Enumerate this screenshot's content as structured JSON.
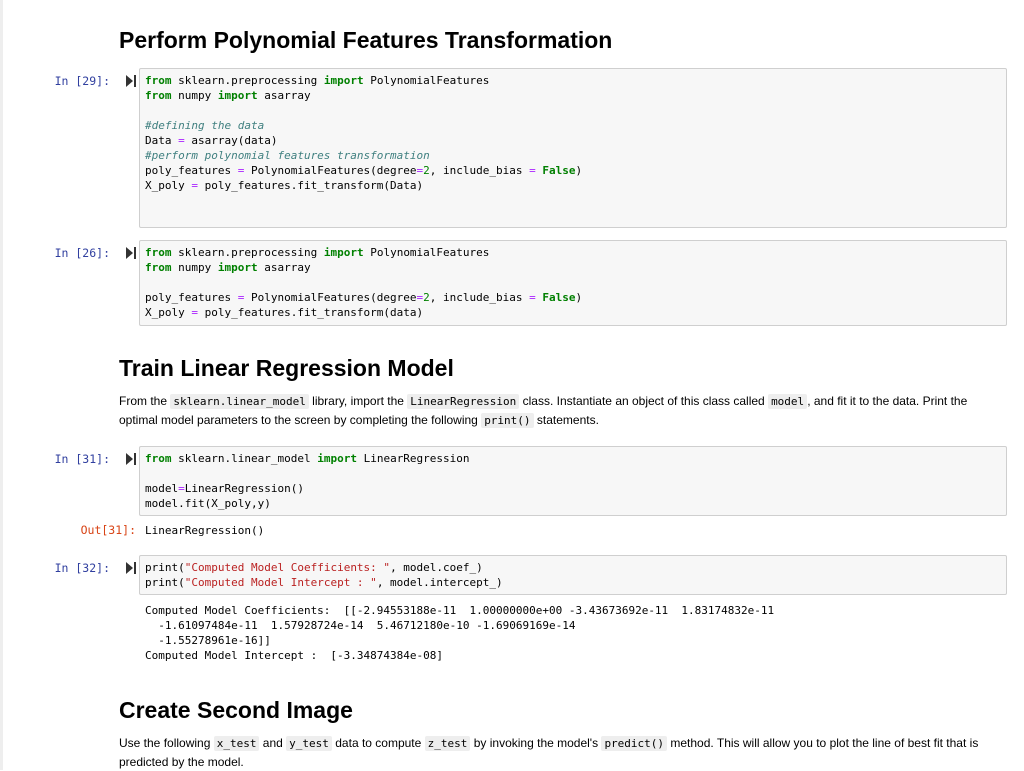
{
  "sections": {
    "poly_heading": "Perform Polynomial Features Transformation",
    "train_heading": "Train Linear Regression Model",
    "second_heading": "Create Second Image"
  },
  "train_para": {
    "t1": "From the ",
    "c1": "sklearn.linear_model",
    "t2": " library, import the ",
    "c2": "LinearRegression",
    "t3": " class. Instantiate an object of this class called ",
    "c3": "model",
    "t4": ", and fit it to the data. Print the optimal model parameters to the screen by completing the following ",
    "c4": "print()",
    "t5": " statements."
  },
  "second_para": {
    "t1": "Use the following ",
    "c1": "x_test",
    "t2": " and ",
    "c2": "y_test",
    "t3": " data to compute ",
    "c3": "z_test",
    "t4": " by invoking the model's ",
    "c4": "predict()",
    "t5": " method. This will allow you to plot the line of best fit that is predicted by the model."
  },
  "cells": {
    "c29": {
      "prompt": "In [29]:",
      "l1": {
        "a": "from",
        "b": " sklearn.preprocessing ",
        "c": "import",
        "d": " PolynomialFeatures"
      },
      "l2": {
        "a": "from",
        "b": " numpy ",
        "c": "import",
        "d": " asarray"
      },
      "l3": "#defining the data",
      "l4": {
        "a": "Data ",
        "b": "=",
        "c": " asarray(data)"
      },
      "l5": "#perform polynomial features transformation",
      "l6": {
        "a": "poly_features ",
        "b": "=",
        "c": " PolynomialFeatures(degree",
        "d": "=",
        "e": "2",
        "f": ", include_bias ",
        "g": "=",
        "h": " ",
        "i": "False",
        "j": ")"
      },
      "l7": {
        "a": "X_poly ",
        "b": "=",
        "c": " poly_features.fit_transform(Data)"
      }
    },
    "c26": {
      "prompt": "In [26]:",
      "l1": {
        "a": "from",
        "b": " sklearn.preprocessing ",
        "c": "import",
        "d": " PolynomialFeatures"
      },
      "l2": {
        "a": "from",
        "b": " numpy ",
        "c": "import",
        "d": " asarray"
      },
      "l3": {
        "a": "poly_features ",
        "b": "=",
        "c": " PolynomialFeatures(degree",
        "d": "=",
        "e": "2",
        "f": ", include_bias ",
        "g": "=",
        "h": " ",
        "i": "False",
        "j": ")"
      },
      "l4": {
        "a": "X_poly ",
        "b": "=",
        "c": " poly_features.fit_transform(data)"
      }
    },
    "c31": {
      "prompt": "In [31]:",
      "l1": {
        "a": "from",
        "b": " sklearn.linear_model ",
        "c": "import",
        "d": " LinearRegression"
      },
      "l2": {
        "a": "model",
        "b": "=",
        "c": "LinearRegression()"
      },
      "l3": {
        "a": "model.fit(X_poly,y)"
      },
      "out_prompt": "Out[31]:",
      "output": "LinearRegression()"
    },
    "c32": {
      "prompt": "In [32]:",
      "l1": {
        "a": "print(",
        "b": "\"Computed Model Coefficients: \"",
        "c": ", model.coef_)"
      },
      "l2": {
        "a": "print(",
        "b": "\"Computed Model Intercept : \"",
        "c": ", model.intercept_)"
      },
      "output": "Computed Model Coefficients:  [[-2.94553188e-11  1.00000000e+00 -3.43673692e-11  1.83174832e-11\n  -1.61097484e-11  1.57928724e-14  5.46712180e-10 -1.69069169e-14\n  -1.55278961e-16]]\nComputed Model Intercept :  [-3.34874384e-08]"
    }
  },
  "colors": {
    "keyword": "#008000",
    "operator": "#aa22ff",
    "comment": "#408080",
    "string": "#ba2121",
    "in_prompt": "#303f9f",
    "out_prompt": "#d84315"
  },
  "icons": {
    "run": "run-cell-icon"
  }
}
